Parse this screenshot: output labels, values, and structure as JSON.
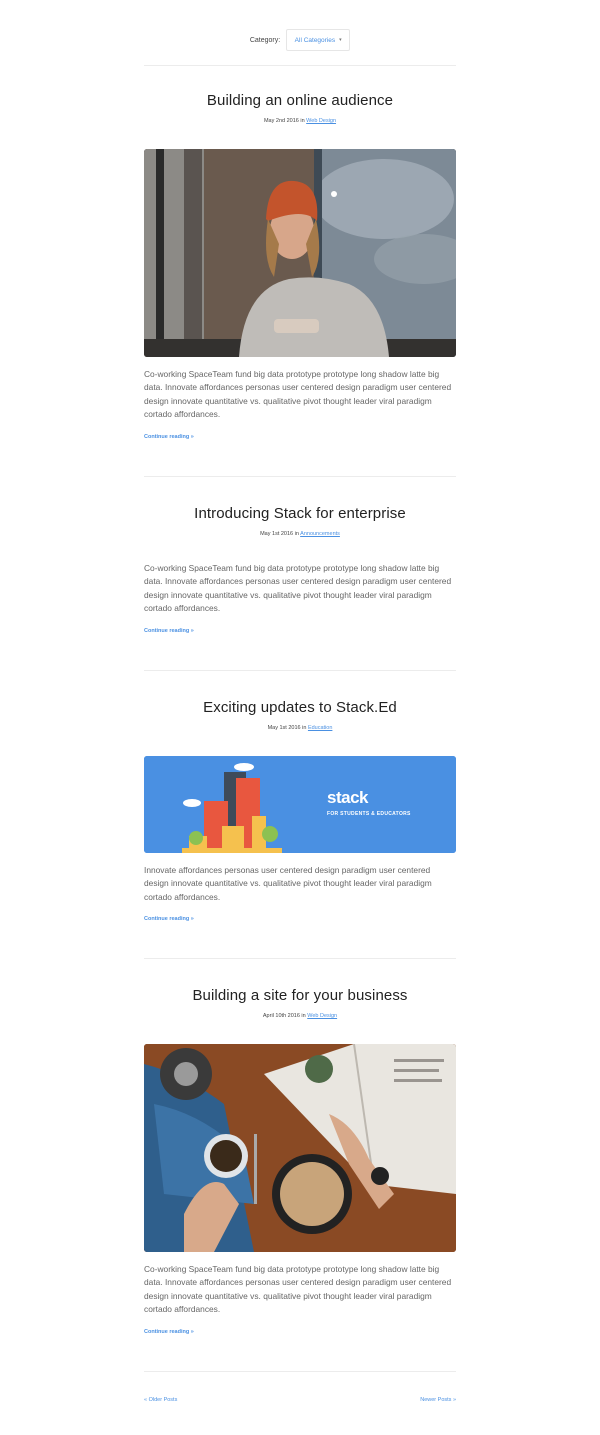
{
  "filter": {
    "label": "Category:",
    "selected": "All Categories",
    "caret": "▾"
  },
  "posts": [
    {
      "title": "Building an online audience",
      "date": "May 2nd 2016 in",
      "category": "Web Design",
      "excerpt": "Co-working SpaceTeam fund big data prototype prototype long shadow latte big data. Innovate affordances personas user centered design paradigm user centered design innovate quantitative vs. qualitative pivot thought leader viral paradigm cortado affordances.",
      "more": "Continue reading »"
    },
    {
      "title": "Introducing Stack for enterprise",
      "date": "May 1st 2016 in",
      "category": "Announcements",
      "excerpt": "Co-working SpaceTeam fund big data prototype prototype long shadow latte big data. Innovate affordances personas user centered design paradigm user centered design innovate quantitative vs. qualitative pivot thought leader viral paradigm cortado affordances.",
      "more": "Continue reading »"
    },
    {
      "title": "Exciting updates to Stack.Ed",
      "date": "May 1st 2016 in",
      "category": "Education",
      "banner": {
        "brand": "stack",
        "tagline": "FOR STUDENTS & EDUCATORS",
        "bg": "#4a90e2"
      },
      "excerpt": "Innovate affordances personas user centered design paradigm user centered design innovate quantitative vs. qualitative pivot thought leader viral paradigm cortado affordances.",
      "more": "Continue reading »"
    },
    {
      "title": "Building a site for your business",
      "date": "April 10th 2016 in",
      "category": "Web Design",
      "excerpt": "Co-working SpaceTeam fund big data prototype prototype long shadow latte big data. Innovate affordances personas user centered design paradigm user centered design innovate quantitative vs. qualitative pivot thought leader viral paradigm cortado affordances.",
      "more": "Continue reading »"
    }
  ],
  "pagination": {
    "older": "« Older Posts",
    "newer": "Newer Posts »"
  },
  "colors": {
    "accent": "#4a90e2",
    "title": "#222222",
    "body": "#666666"
  }
}
